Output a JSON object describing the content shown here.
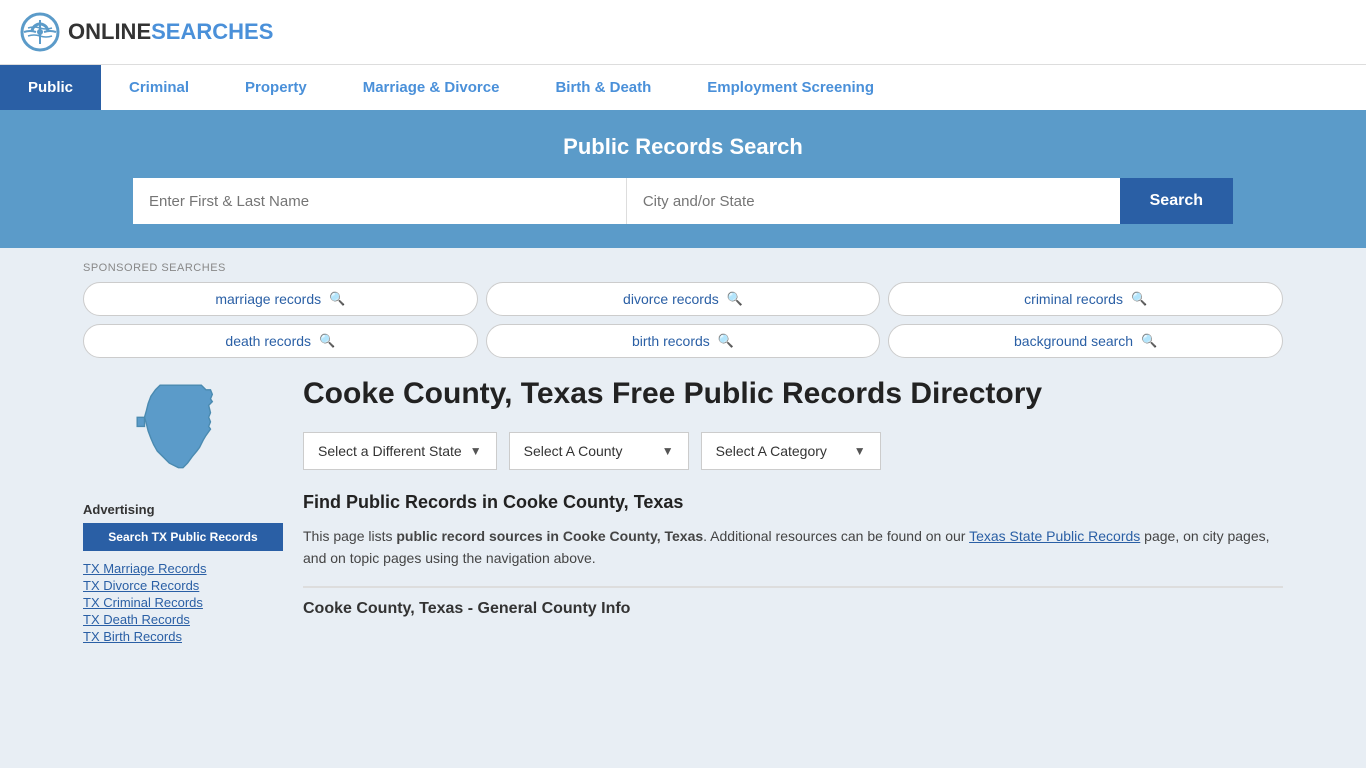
{
  "header": {
    "logo_online": "ONLINE",
    "logo_searches": "SEARCHES"
  },
  "nav": {
    "items": [
      {
        "label": "Public",
        "active": true
      },
      {
        "label": "Criminal",
        "active": false
      },
      {
        "label": "Property",
        "active": false
      },
      {
        "label": "Marriage & Divorce",
        "active": false
      },
      {
        "label": "Birth & Death",
        "active": false
      },
      {
        "label": "Employment Screening",
        "active": false
      }
    ]
  },
  "hero": {
    "title": "Public Records Search",
    "name_placeholder": "Enter First & Last Name",
    "location_placeholder": "City and/or State",
    "search_button": "Search"
  },
  "sponsored": {
    "label": "SPONSORED SEARCHES",
    "items": [
      "marriage records",
      "divorce records",
      "criminal records",
      "death records",
      "birth records",
      "background search"
    ]
  },
  "page": {
    "title": "Cooke County, Texas Free Public Records Directory",
    "dropdowns": {
      "state": "Select a Different State",
      "county": "Select A County",
      "category": "Select A Category"
    }
  },
  "find_section": {
    "title": "Find Public Records in Cooke County, Texas",
    "text_part1": "This page lists ",
    "text_bold": "public record sources in Cooke County, Texas",
    "text_part2": ". Additional resources can be found on our ",
    "link_text": "Texas State Public Records",
    "text_part3": " page, on city pages, and on topic pages using the navigation above."
  },
  "general_info": {
    "header": "Cooke County, Texas - General County Info"
  },
  "sidebar": {
    "advertising_label": "Advertising",
    "ad_button": "Search TX Public Records",
    "links": [
      "TX Marriage Records",
      "TX Divorce Records",
      "TX Criminal Records",
      "TX Death Records",
      "TX Birth Records"
    ]
  }
}
